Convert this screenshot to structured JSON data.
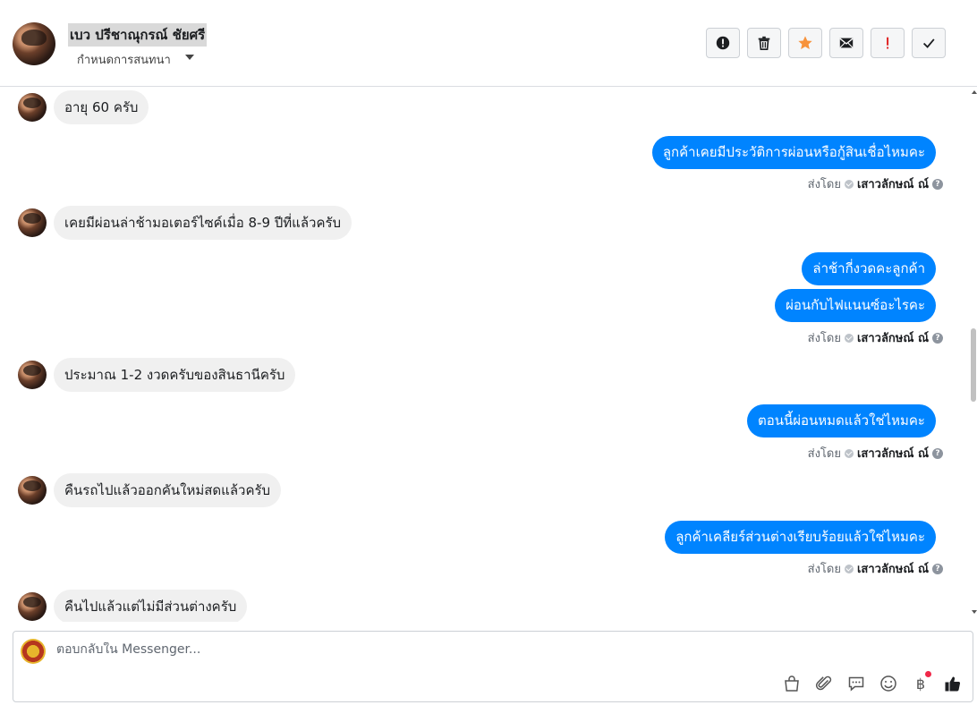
{
  "header": {
    "contact_name": "เบว ปรีชาณุกรณ์ ชัยศรี",
    "subtitle": "กำหนดการสนทนา",
    "actions": [
      {
        "name": "report-icon",
        "symbol": "!"
      },
      {
        "name": "trash-icon",
        "symbol": "trash"
      },
      {
        "name": "star-icon",
        "symbol": "star",
        "color": "#f7923b"
      },
      {
        "name": "mail-icon",
        "symbol": "mail"
      },
      {
        "name": "important-icon",
        "symbol": "!",
        "color": "#e02020"
      },
      {
        "name": "check-icon",
        "symbol": "check"
      }
    ]
  },
  "thread": {
    "sent_by_label": "ส่งโดย",
    "sender": "เสาวลักษณ์ ณ์",
    "messages": [
      {
        "dir": "in",
        "text": "อายุ 60 ครับ"
      },
      {
        "dir": "out",
        "text": "ลูกค้าเคยมีประวัติการผ่อนหรือกู้สินเชื่อไหมคะ"
      },
      {
        "dir": "in",
        "text": "เคยมีผ่อนล่าช้ามอเตอร์ไซค์เมื่อ 8-9 ปีที่แล้วครับ"
      },
      {
        "dir": "out",
        "text": "ล่าช้ากี่งวดคะลูกค้า"
      },
      {
        "dir": "out",
        "text": "ผ่อนกับไฟแนนซ์อะไรคะ"
      },
      {
        "dir": "in",
        "text": "ประมาณ 1-2 งวดครับของสินธานีครับ"
      },
      {
        "dir": "out",
        "text": "ตอนนี้ผ่อนหมดแล้วใช่ไหมคะ"
      },
      {
        "dir": "in",
        "text": "คืนรถไปแล้วออกคันใหม่สดแล้วครับ"
      },
      {
        "dir": "out",
        "text": "ลูกค้าเคลียร์ส่วนต่างเรียบร้อยแล้วใช่ไหมคะ"
      },
      {
        "dir": "in",
        "text": "คืนไปแล้วแต่ไม่มีส่วนต่างครับ"
      }
    ]
  },
  "composer": {
    "placeholder": "ตอบกลับใน Messenger...",
    "tools": [
      "bag-icon",
      "paperclip-icon",
      "saved-reply-icon",
      "emoji-icon",
      "baht-icon",
      "thumbs-up-icon"
    ]
  },
  "colors": {
    "outgoing_bubble": "#0084ff",
    "incoming_bubble": "#f0f0f0",
    "notify_dot": "#f02849"
  }
}
